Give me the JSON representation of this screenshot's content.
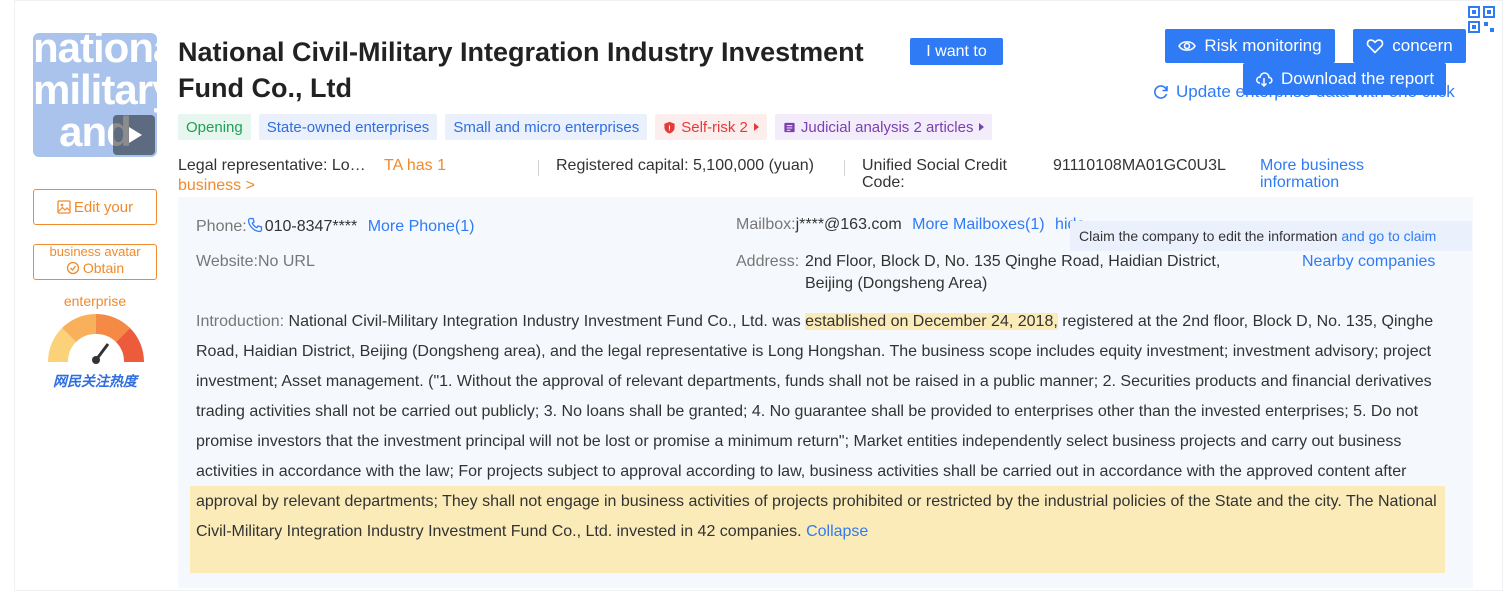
{
  "logo": {
    "text": "national\nmilitary\nand\ncivilian",
    "play_icon": "play-icon"
  },
  "side": {
    "edit_label": "Edit your",
    "obtain_line1": "business avatar",
    "obtain_label": "Obtain",
    "gauge_title": "enterprise",
    "gauge_label": "网民关注热度"
  },
  "company": {
    "name": "National Civil-Military Integration Industry Investment Fund Co., Ltd",
    "want_btn": "I want to"
  },
  "tags": [
    {
      "label": "Opening"
    },
    {
      "label": "State-owned enterprises"
    },
    {
      "label": "Small and micro enterprises"
    },
    {
      "label": "Self-risk 2"
    },
    {
      "label": "Judicial analysis 2 articles"
    }
  ],
  "actions": {
    "risk": "Risk monitoring",
    "concern": "concern",
    "download": "Download the report",
    "update": "Update enterprise data with one click"
  },
  "info": {
    "legal_label": "Legal representative: Long Hongshan",
    "ta_link": "TA has 1",
    "biz_link": "business >",
    "capital": "Registered capital: 5,100,000 (yuan)",
    "uscc_label": "Unified Social Credit Code:",
    "uscc_value": "91110108MA01GC0U3L",
    "more_biz": "More business information"
  },
  "contact": {
    "phone_label": "Phone:",
    "phone_value": "010-8347****",
    "more_phone": "More Phone(1)",
    "mail_label": "Mailbox:",
    "mail_value": "j****@163.com",
    "more_mail": "More Mailboxes(1)",
    "hide": "hide",
    "website_label": "Website:",
    "website_value": "No URL",
    "address_label": "Address:",
    "address_line1": "2nd Floor, Block D, No. 135 Qinghe Road, Haidian District,",
    "address_line2": "Beijing (Dongsheng Area)",
    "nearby": "Nearby companies",
    "claim_text": "Claim the company to edit the information",
    "claim_link": "and go to claim"
  },
  "intro": {
    "label": "Introduction:",
    "part1": " National Civil-Military Integration Industry Investment Fund Co., Ltd. was ",
    "highlight": "established on December 24, 2018,",
    "part2": " registered at the 2nd floor, Block D, No. 135, Qinghe Road, Haidian District, Beijing (Dongsheng area), and the legal representative is Long Hongshan. The business scope includes equity investment; investment advisory; project investment; Asset management. (\"1. Without the approval of relevant departments, funds shall not be raised in a public manner; 2. Securities products and financial derivatives trading activities shall not be carried out publicly; 3. No loans shall be granted; 4. No guarantee shall be provided to enterprises other than the invested enterprises; 5. Do not promise investors that the investment principal will not be lost or promise a minimum return\"; Market entities independently select business projects and carry out business activities in accordance with the law; For projects subject to approval according to law, business activities shall be carried out in accordance with the approved content after approval by relevant departments; They shall not engage in business activities of projects prohibited or restricted by the industrial policies of the State and the city. The National Civil-Military Integration Industry Investment Fund Co., Ltd. invested in 42 companies. ",
    "collapse": "Collapse"
  },
  "colors": {
    "accent": "#2f7bf5",
    "orange": "#f08a2d",
    "highlight": "#faebb8"
  }
}
